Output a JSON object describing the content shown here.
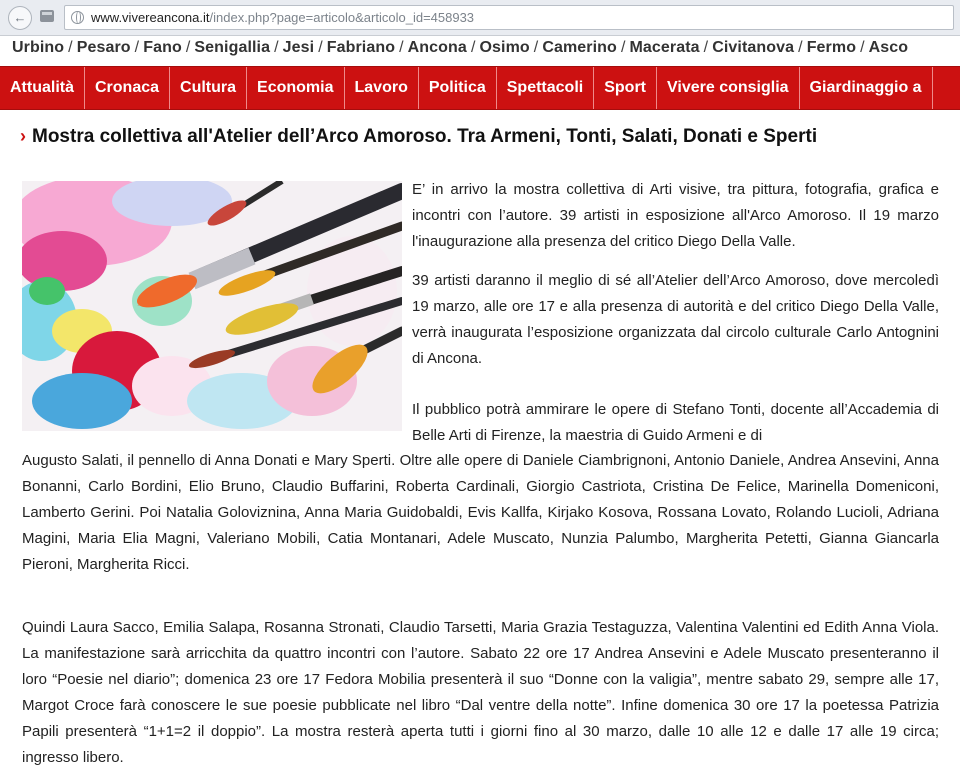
{
  "browser": {
    "url_host": "www.vivereancona.it",
    "url_path": "/index.php?page=articolo&articolo_id=458933"
  },
  "cities": [
    "Urbino",
    "Pesaro",
    "Fano",
    "Senigallia",
    "Jesi",
    "Fabriano",
    "Ancona",
    "Osimo",
    "Camerino",
    "Macerata",
    "Civitanova",
    "Fermo",
    "Asco"
  ],
  "menu": [
    "Attualità",
    "Cronaca",
    "Cultura",
    "Economia",
    "Lavoro",
    "Politica",
    "Spettacoli",
    "Sport",
    "Vivere consiglia",
    "Giardinaggio a"
  ],
  "article": {
    "title": "Mostra collettiva all'Atelier dell’Arco Amoroso. Tra Armeni, Tonti, Salati, Donati e Sperti",
    "p1": "E’ in arrivo la mostra collettiva di Arti visive, tra pittura, fotografia, grafica e incontri con l’autore. 39 artisti in esposizione all'Arco Amoroso. Il 19 marzo l'inaugurazione alla presenza del critico Diego Della Valle.",
    "p2": "39 artisti daranno il meglio di sé all’Atelier dell’Arco Amoroso, dove mercoledì 19 marzo, alle ore 17 e alla presenza di autorità e del critico Diego Della Valle, verrà inaugurata l’esposizione organizzata dal circolo culturale Carlo Antognini di Ancona.",
    "p3a": "Il pubblico potrà ammirare le opere di Stefano Tonti, docente all’Accademia di Belle Arti di Firenze, la maestria di Guido Armeni e di",
    "p3b": "Augusto Salati, il pennello di Anna Donati e Mary Sperti. Oltre alle opere di Daniele Ciambrignoni, Antonio Daniele, Andrea Ansevini, Anna Bonanni, Carlo Bordini, Elio Bruno, Claudio Buffarini, Roberta Cardinali, Giorgio Castriota, Cristina De Felice, Marinella Domeniconi, Lamberto Gerini. Poi Natalia Goloviznina, Anna Maria Guidobaldi, Evis Kallfa, Kirjako Kosova, Rossana Lovato, Rolando Lucioli, Adriana Magini, Maria Elia Magni, Valeriano Mobili, Catia Montanari, Adele Muscato, Nunzia Palumbo, Margherita Petetti, Gianna Giancarla Pieroni, Margherita Ricci.",
    "p4": "Quindi Laura Sacco, Emilia Salapa, Rosanna Stronati, Claudio Tarsetti, Maria Grazia Testaguzza, Valentina Valentini ed Edith Anna Viola. La manifestazione sarà arricchita da quattro incontri con l’autore. Sabato 22 ore 17 Andrea Ansevini e Adele Muscato presenteranno il loro “Poesie nel diario”; domenica 23 ore 17 Fedora Mobilia presenterà il suo “Donne con la valigia”, mentre sabato 29, sempre alle 17, Margot Croce farà conoscere le sue poesie pubblicate nel libro “Dal ventre della notte”. Infine domenica 30 ore 17 la poetessa Patrizia Papili presenterà “1+1=2 il doppio”. La mostra resterà aperta tutti i giorni fino al 30 marzo, dalle 10 alle 12 e dalle 17 alle 19 circa; ingresso libero."
  }
}
